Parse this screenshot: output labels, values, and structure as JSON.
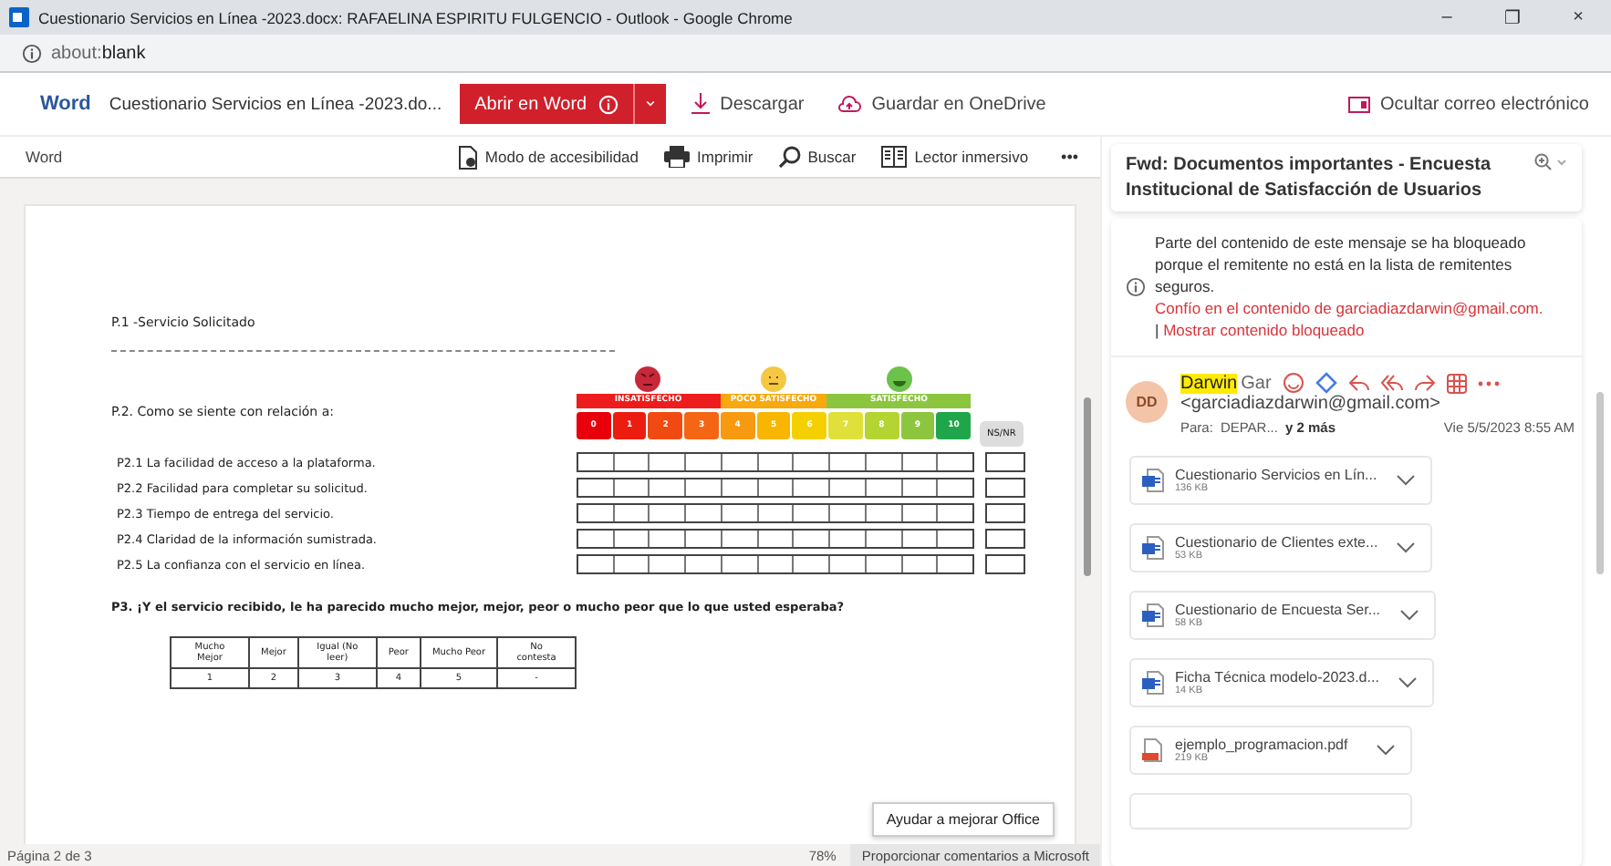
{
  "window": {
    "title": "Cuestionario Servicios en Línea -2023.docx: RAFAELINA ESPIRITU FULGENCIO - Outlook - Google Chrome",
    "controls": [
      "–",
      "❐",
      "×"
    ]
  },
  "address": "about:**blank**",
  "word_bar": {
    "app": "Word",
    "doc_title": "Cuestionario Servicios en Línea -2023.do...",
    "open_button": "Abrir en Word",
    "download": "Descargar",
    "save": "Guardar en OneDrive",
    "hide": "Ocultar correo electrónico"
  },
  "toolbar": {
    "label": "Word",
    "actions": [
      {
        "kind": "accessibility",
        "label": "Modo de accesibilidad"
      },
      {
        "kind": "print",
        "label": "Imprimir"
      },
      {
        "kind": "search",
        "label": "Buscar"
      },
      {
        "kind": "reader",
        "label": "Lector inmersivo"
      }
    ],
    "more": "•••"
  },
  "document": {
    "p1": "P.1 -Servicio Solicitado",
    "p2": "P.2. Como se siente con relación a:",
    "bands": [
      {
        "label": "INSATISFECHO",
        "color": "#ee1c1c",
        "kind": "angry"
      },
      {
        "label": "POCO SATISFECHO",
        "color": "#f7a90d",
        "kind": "neutral"
      },
      {
        "label": "SATISFECHO",
        "color": "#8cc63f",
        "kind": "happy"
      }
    ],
    "scale": [
      {
        "label": "0",
        "color": "#e8000b"
      },
      {
        "label": "1",
        "color": "#ec1c10"
      },
      {
        "label": "2",
        "color": "#f04a12"
      },
      {
        "label": "3",
        "color": "#f46614"
      },
      {
        "label": "4",
        "color": "#f89a10"
      },
      {
        "label": "5",
        "color": "#f8b600"
      },
      {
        "label": "6",
        "color": "#f5d000"
      },
      {
        "label": "7",
        "color": "#dfe03a"
      },
      {
        "label": "8",
        "color": "#b4d432"
      },
      {
        "label": "9",
        "color": "#8cc63f"
      },
      {
        "label": "10",
        "color": "#1fa64a"
      }
    ],
    "nsnr": "NS/NR",
    "items": [
      "P2.1 La facilidad de acceso a la plataforma.",
      "P2.2 Facilidad para completar su solicitud.",
      "P2.3 Tiempo de entrega del servicio.",
      "P2.4 Claridad de la información sumistrada.",
      "P2.5 La confianza con el servicio en línea."
    ],
    "p3": "P3. ¡Y el servicio recibido, le ha parecido mucho mejor, mejor, peor o mucho peor que lo que usted esperaba?",
    "table": {
      "columns": [
        "Mucho Mejor",
        "Mejor",
        "Igual (No leer)",
        "Peor",
        "Mucho Peor",
        "No contesta"
      ],
      "values": [
        "1",
        "2",
        "3",
        "4",
        "5",
        "-"
      ]
    }
  },
  "tooltip": "Ayudar a mejorar Office",
  "status": {
    "page": "Página 2 de 3",
    "zoom": "78%",
    "feedback": "Proporcionar comentarios a Microsoft"
  },
  "email": {
    "subject": "Fwd: Documentos importantes - Encuesta Institucional de Satisfacción de Usuarios",
    "notice": "Parte del contenido de este mensaje se ha bloqueado porque el remitente no está en la lista de remitentes seguros.",
    "trust_link": "Confío en el contenido de garciadiazdarwin@gmail.com.",
    "separator": "|",
    "show_link": "Mostrar contenido bloqueado",
    "sender": {
      "initials": "DD",
      "name_highlight": "Darwin",
      "name_rest": "Gar",
      "address": "<garciadiazdarwin@gmail.com>",
      "to_label": "Para:",
      "to": "DEPAR...",
      "more": "y 2 más",
      "date": "Vie 5/5/2023 8:55 AM"
    },
    "attachments": [
      {
        "kind": "word",
        "name": "Cuestionario Servicios en Lín...",
        "size": "136 KB"
      },
      {
        "kind": "word",
        "name": "Cuestionario de Clientes exte...",
        "size": "53 KB"
      },
      {
        "kind": "word",
        "name": "Cuestionario de Encuesta Ser...",
        "size": "58 KB"
      },
      {
        "kind": "word",
        "name": "Ficha Técnica modelo-2023.d...",
        "size": "14 KB"
      },
      {
        "kind": "pdf",
        "name": "ejemplo_programacion.pdf",
        "size": "219 KB"
      }
    ]
  }
}
